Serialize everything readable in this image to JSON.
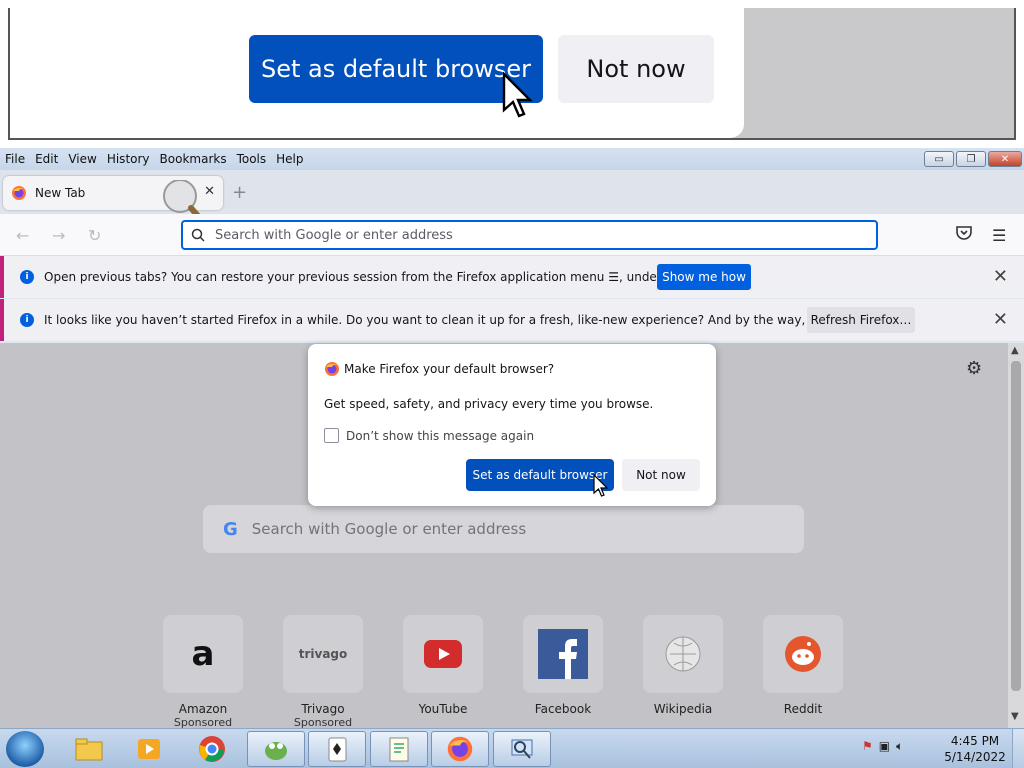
{
  "zoom_inset": {
    "primary_button": "Set as default browser",
    "secondary_button": "Not now"
  },
  "menubar": {
    "items": [
      "File",
      "Edit",
      "View",
      "History",
      "Bookmarks",
      "Tools",
      "Help"
    ]
  },
  "window_controls": {
    "minimize": "▭",
    "restore": "❐",
    "close": "✕"
  },
  "tabbar": {
    "tab_title": "New Tab",
    "close_glyph": "✕",
    "new_tab_glyph": "+"
  },
  "navbar": {
    "url_placeholder": "Search with Google or enter address"
  },
  "notifications": [
    {
      "message": "Open previous tabs? You can restore your previous session from the Firefox application menu ☰, under History.",
      "button": "Show me how"
    },
    {
      "message": "It looks like you haven’t started Firefox in a while. Do you want to clean it up for a fresh, like-new experience? And by the way, welcome back!",
      "button": "Refresh Firefox…"
    }
  ],
  "newtab": {
    "search_placeholder": "Search with Google or enter address",
    "google_glyph": "G",
    "top_sites": [
      {
        "name": "Amazon",
        "sub": "Sponsored"
      },
      {
        "name": "Trivago",
        "sub": "Sponsored"
      },
      {
        "name": "YouTube",
        "sub": ""
      },
      {
        "name": "Facebook",
        "sub": ""
      },
      {
        "name": "Wikipedia",
        "sub": ""
      },
      {
        "name": "Reddit",
        "sub": ""
      }
    ],
    "amazon_logo": "a",
    "trivago_logo": "trivago"
  },
  "dialog": {
    "title": "Make Firefox your default browser?",
    "body": "Get speed, safety, and privacy every time you browse.",
    "checkbox_label": "Don’t show this message again",
    "checkbox_checked": false,
    "primary_button": "Set as default browser",
    "secondary_button": "Not now"
  },
  "taskbar": {
    "clock_time": "4:45 PM",
    "clock_date": "5/14/2022"
  },
  "colors": {
    "primary_blue": "#0250bb",
    "notification_accent": "#c1207b",
    "focus_ring": "#0061e0"
  }
}
